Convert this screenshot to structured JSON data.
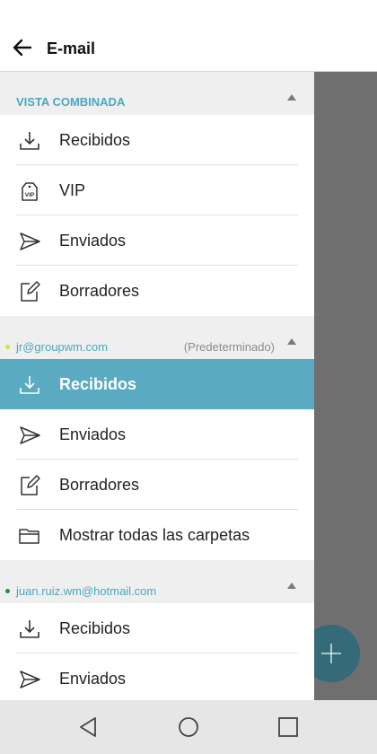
{
  "header": {
    "title": "E-mail"
  },
  "combined": {
    "title": "VISTA COMBINADA",
    "items": [
      {
        "label": "Recibidos",
        "icon": "inbox-download-icon"
      },
      {
        "label": "VIP",
        "icon": "vip-tag-icon"
      },
      {
        "label": "Enviados",
        "icon": "send-icon"
      },
      {
        "label": "Borradores",
        "icon": "draft-edit-icon"
      }
    ]
  },
  "account1": {
    "email": "jr@groupwm.com",
    "note": "(Predeterminado)",
    "dot_color": "#d7df3a",
    "items": [
      {
        "label": "Recibidos",
        "icon": "inbox-download-icon",
        "selected": true
      },
      {
        "label": "Enviados",
        "icon": "send-icon"
      },
      {
        "label": "Borradores",
        "icon": "draft-edit-icon"
      },
      {
        "label": "Mostrar todas las carpetas",
        "icon": "folder-icon"
      }
    ]
  },
  "account2": {
    "email": "juan.ruiz.wm@hotmail.com",
    "dot_color": "#2e8b3a",
    "items": [
      {
        "label": "Recibidos",
        "icon": "inbox-download-icon"
      },
      {
        "label": "Enviados",
        "icon": "send-icon"
      }
    ]
  },
  "colors": {
    "accent": "#4aa8bf",
    "selected_bg": "#5aabc2",
    "fab": "#356a78",
    "scrim": "#6f6f6f"
  },
  "navbar": {
    "buttons": [
      "back-triangle-icon",
      "home-circle-icon",
      "recents-square-icon"
    ]
  }
}
